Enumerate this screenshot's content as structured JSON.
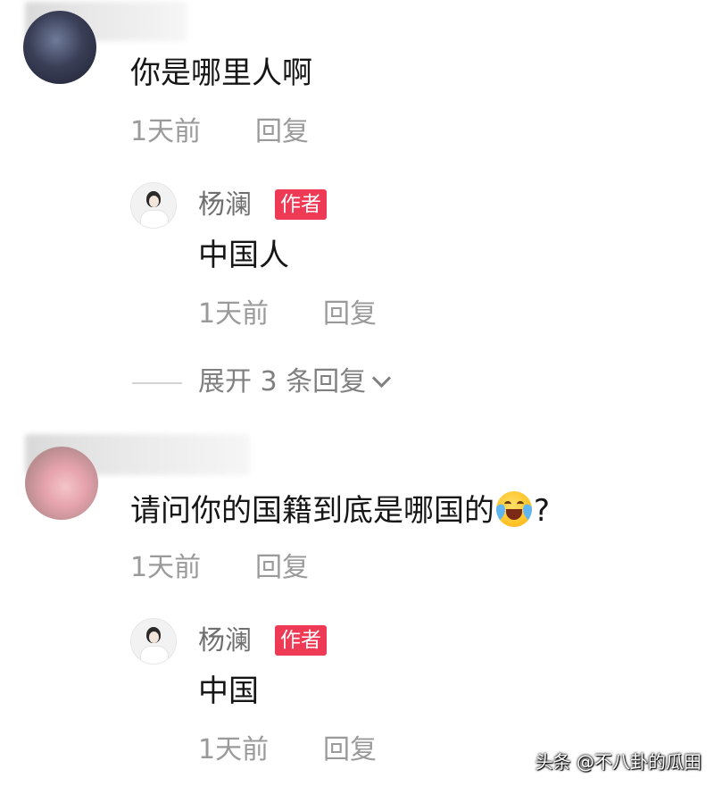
{
  "comments": [
    {
      "text": "你是哪里人啊",
      "meta": {
        "time": "1天前",
        "reply_label": "回复"
      },
      "author_reply": {
        "name": "杨澜",
        "badge": "作者",
        "text": "中国人",
        "meta": {
          "time": "1天前",
          "reply_label": "回复"
        }
      },
      "expand_label": "展开 3 条回复"
    },
    {
      "text_before_emoji": "请问你的国籍到底是哪国的",
      "emoji": "laughing-crying-emoji",
      "text_after_emoji": "?",
      "meta": {
        "time": "1天前",
        "reply_label": "回复"
      },
      "author_reply": {
        "name": "杨澜",
        "badge": "作者",
        "text": "中国",
        "meta": {
          "time": "1天前",
          "reply_label": "回复"
        }
      }
    }
  ],
  "watermark": "头条 @不八卦的瓜田",
  "colors": {
    "badge_bg": "#ef3a56",
    "meta_text": "#9a9a9a",
    "primary_text": "#161616"
  }
}
